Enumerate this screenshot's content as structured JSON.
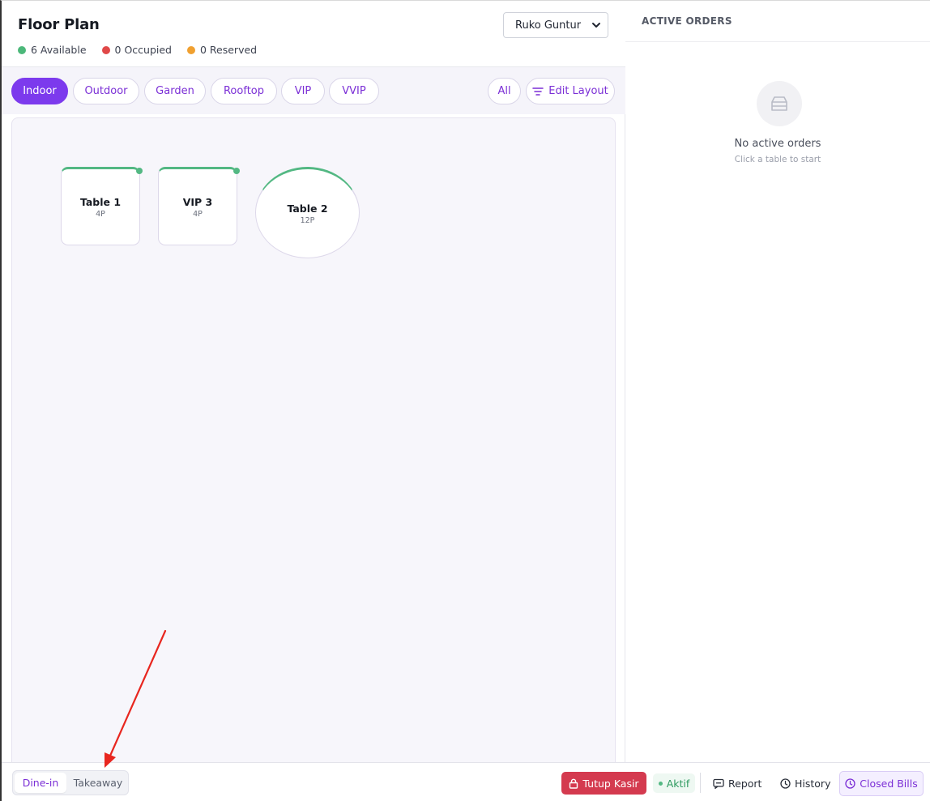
{
  "header": {
    "title": "Floor Plan",
    "legend": [
      {
        "label": "6 Available",
        "color": "#4cb87a"
      },
      {
        "label": "0 Occupied",
        "color": "#e04848"
      },
      {
        "label": "0 Reserved",
        "color": "#f0a030"
      }
    ],
    "location": {
      "selected": "Ruko Guntur"
    }
  },
  "toolbar": {
    "areas": [
      "Indoor",
      "Outdoor",
      "Garden",
      "Rooftop",
      "VIP",
      "VVIP"
    ],
    "active_area": "Indoor",
    "all_label": "All",
    "edit_layout_label": "Edit Layout"
  },
  "tables": [
    {
      "name": "Table 1",
      "capacity": "4P",
      "shape": "square",
      "status": "available"
    },
    {
      "name": "VIP 3",
      "capacity": "4P",
      "shape": "square",
      "status": "available"
    },
    {
      "name": "Table 2",
      "capacity": "12P",
      "shape": "round",
      "status": "available"
    }
  ],
  "active_orders": {
    "title": "ACTIVE ORDERS",
    "empty_title": "No active orders",
    "empty_subtitle": "Click a table to start",
    "empty_icon": "inbox-icon"
  },
  "bottombar": {
    "modes": [
      "Dine-in",
      "Takeaway"
    ],
    "active_mode": "Dine-in",
    "close_register_label": "Tutup Kasir",
    "status_label": "Aktif",
    "report_label": "Report",
    "history_label": "History",
    "closed_bills_label": "Closed Bills"
  },
  "colors": {
    "accent": "#7c3aed",
    "danger": "#d43a4f",
    "success": "#53b883",
    "annotation_arrow": "#e8261f"
  }
}
